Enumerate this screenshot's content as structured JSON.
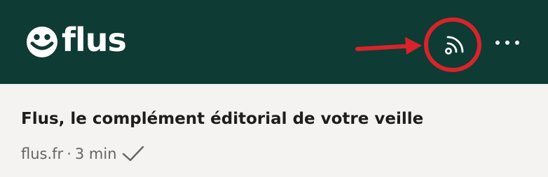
{
  "header": {
    "logo_text": "flus",
    "rss_icon": "rss-feed-icon",
    "more_icon": "more-horizontal-icon"
  },
  "article": {
    "title": "Flus, le complément éditorial de votre veille",
    "source": "flus.fr",
    "separator": "·",
    "reading_time": "3 min",
    "read_icon": "checkmark-icon"
  },
  "annotation": {
    "type": "red-circle-with-arrow",
    "target": "rss-feed-icon"
  },
  "colors": {
    "header_bg": "#0e3b33",
    "page_bg": "#f4f3f1",
    "title_text": "#1d1d1b",
    "meta_text": "#666360",
    "annotation_red": "#d9232a"
  }
}
